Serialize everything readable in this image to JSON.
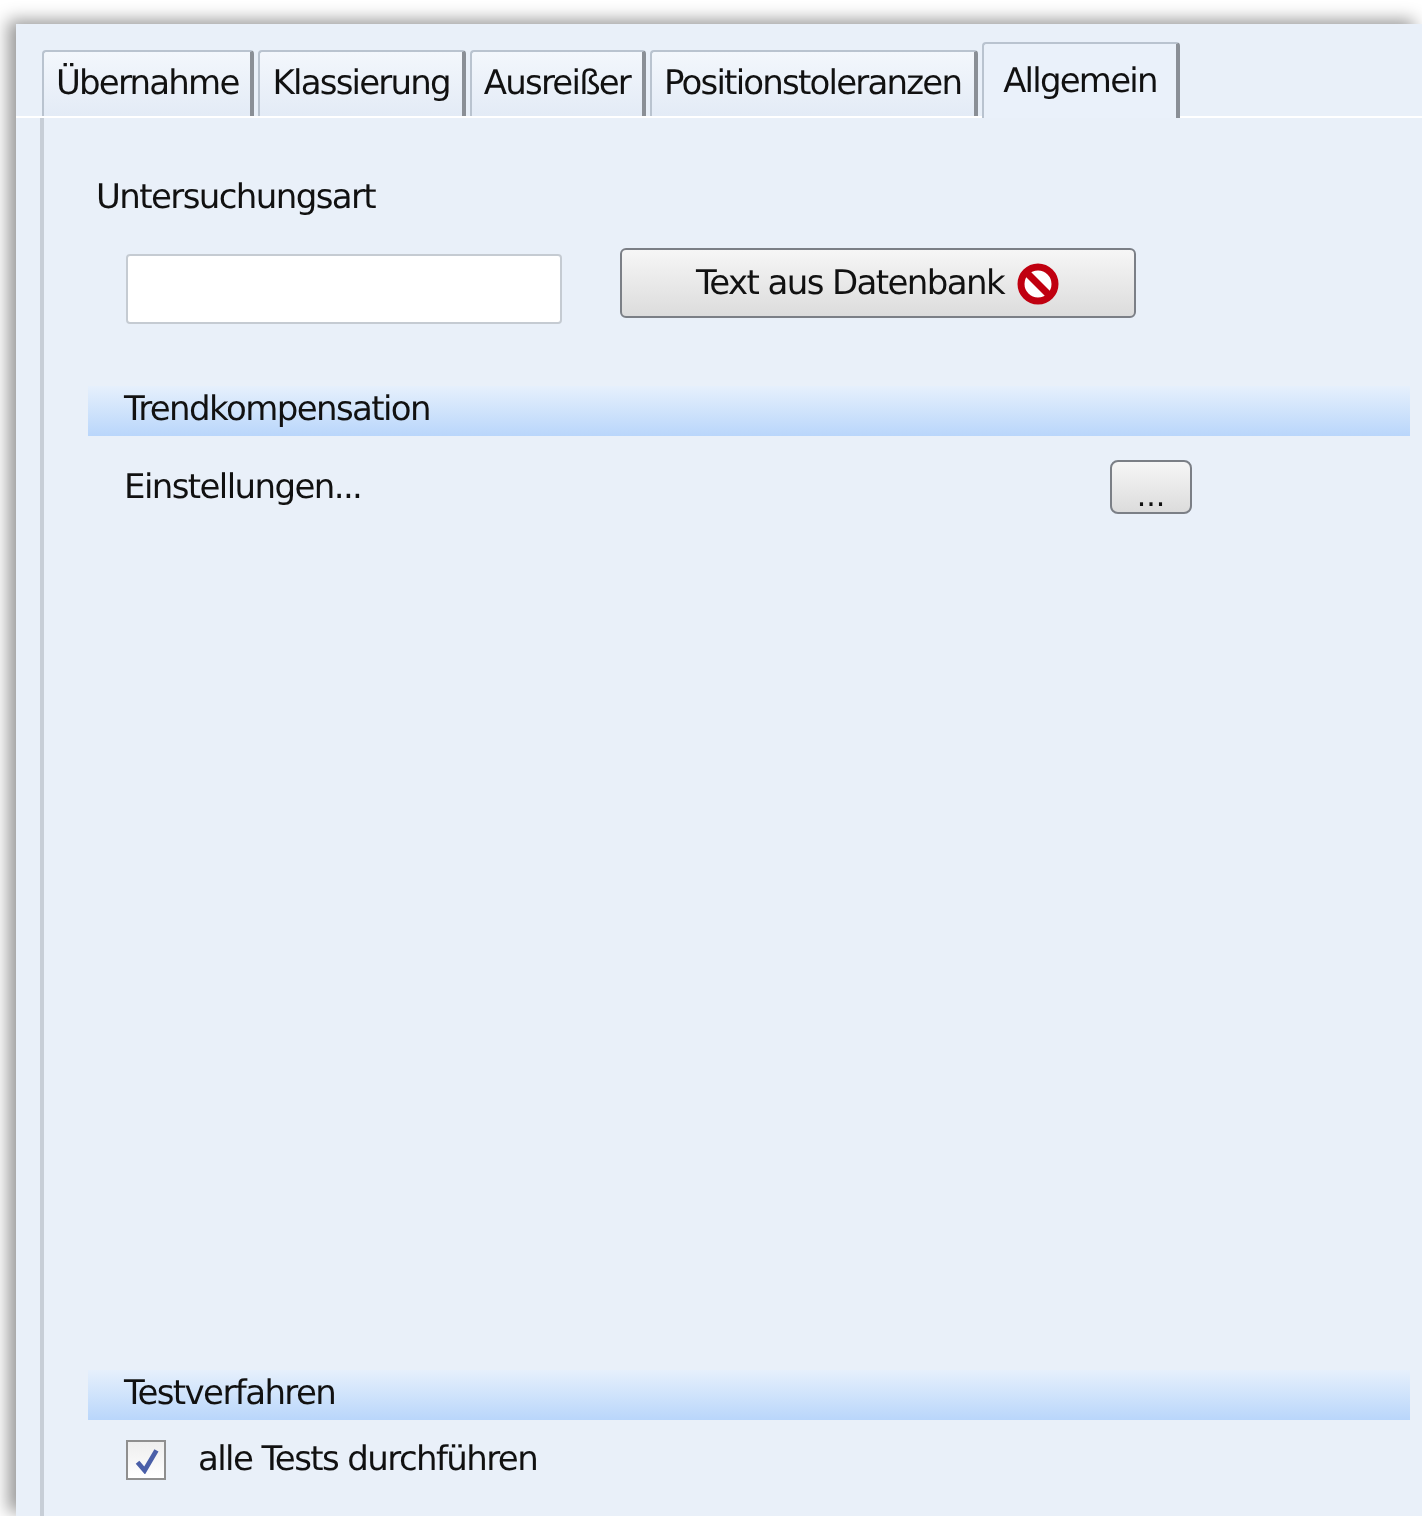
{
  "tabs": [
    {
      "label": "Übernahme",
      "selected": false
    },
    {
      "label": "Klassierung",
      "selected": false
    },
    {
      "label": "Ausreißer",
      "selected": false
    },
    {
      "label": "Positionstoleranzen",
      "selected": false
    },
    {
      "label": "Allgemein",
      "selected": true
    }
  ],
  "untersuchungsart": {
    "label": "Untersuchungsart",
    "button": "Text aus Datenbank"
  },
  "trendkompensation": {
    "title": "Trendkompensation",
    "label": "Einstellungen...",
    "button": "..."
  },
  "testverfahren": {
    "title": "Testverfahren",
    "checkbox": {
      "label": "alle Tests durchführen",
      "checked": true
    }
  }
}
